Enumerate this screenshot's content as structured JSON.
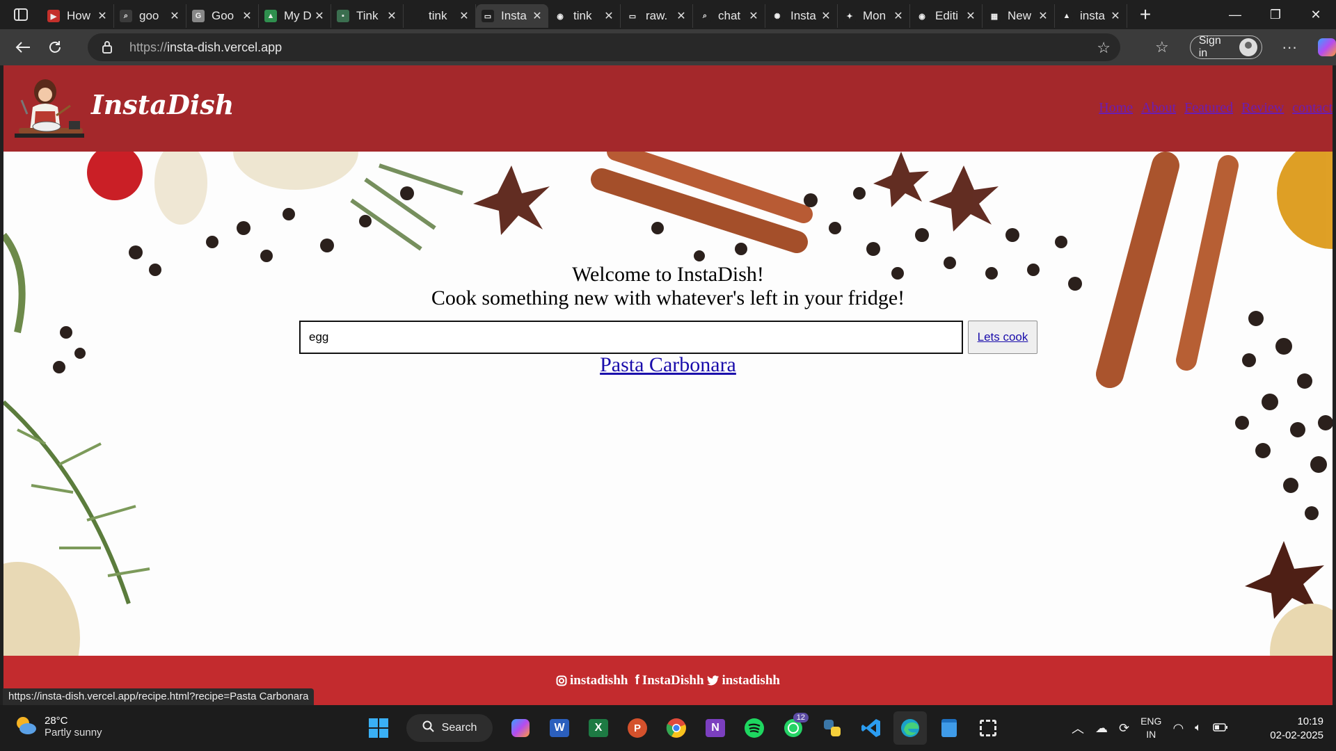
{
  "browser": {
    "tabs": [
      {
        "title": "How",
        "color": "#c4302b",
        "glyph": "▶"
      },
      {
        "title": "goo",
        "color": "#3b3b3b",
        "glyph": "⌕"
      },
      {
        "title": "Goo",
        "color": "#888888",
        "glyph": "G"
      },
      {
        "title": "My D",
        "color": "#2f8f4e",
        "glyph": "▲"
      },
      {
        "title": "Tink",
        "color": "#3b6e4f",
        "glyph": "▪"
      },
      {
        "title": "tink",
        "color": "#1f1f1f",
        "glyph": ""
      },
      {
        "title": "Insta",
        "color": "#1f1f1f",
        "glyph": "▭",
        "active": true
      },
      {
        "title": "tink",
        "color": "#1f1f1f",
        "glyph": "◉"
      },
      {
        "title": "raw.",
        "color": "#1f1f1f",
        "glyph": "▭"
      },
      {
        "title": "chat",
        "color": "#1f1f1f",
        "glyph": "⌕"
      },
      {
        "title": "Insta",
        "color": "#1f1f1f",
        "glyph": "✺"
      },
      {
        "title": "Mon",
        "color": "#1f1f1f",
        "glyph": "✦"
      },
      {
        "title": "Editi",
        "color": "#1f1f1f",
        "glyph": "◉"
      },
      {
        "title": "New",
        "color": "#1f1f1f",
        "glyph": "▦"
      },
      {
        "title": "insta",
        "color": "#1f1f1f",
        "glyph": "▲"
      }
    ],
    "url_prefix": "https://",
    "url_host": "insta-dish.vercel.app",
    "signin_label": "Sign in",
    "status_url": "https://insta-dish.vercel.app/recipe.html?recipe=Pasta Carbonara"
  },
  "site": {
    "brand": "InstaDish",
    "nav": [
      "Home",
      "About",
      "Featured",
      "Review",
      "contact"
    ],
    "welcome": "Welcome to InstaDish!",
    "tagline": "Cook something new with whatever's left in your fridge!",
    "search_value": "egg",
    "cook_button": "Lets cook",
    "result": "Pasta Carbonara",
    "footer": {
      "instagram": "instadishh",
      "facebook": "InstaDishh",
      "twitter": "instadishh"
    }
  },
  "taskbar": {
    "temperature": "28°C",
    "condition": "Partly sunny",
    "search_label": "Search",
    "whatsapp_badge": "12",
    "lang_line1": "ENG",
    "lang_line2": "IN",
    "time": "10:19",
    "date": "02-02-2025"
  }
}
